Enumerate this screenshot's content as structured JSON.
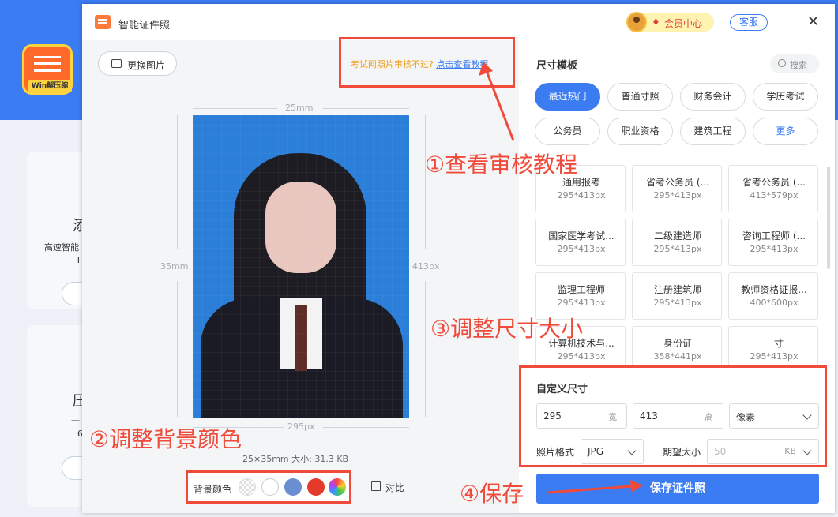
{
  "background_app": {
    "logo_text": "Win解压缩",
    "card1_heading_fragment": "添",
    "card1_desc_fragment_1": "高速智能",
    "card1_desc_fragment_2": "T",
    "card2_heading_fragment": "压",
    "card2_desc_fragment_1": "一",
    "card2_desc_fragment_2": "6"
  },
  "window": {
    "title": "智能证件照",
    "vip_label": "会员中心",
    "service_label": "客服",
    "close_glyph": "✕"
  },
  "toolbar": {
    "replace_image_label": "更换图片",
    "notice_text": "考试网照片审核不过?",
    "notice_link": "点击查看教程"
  },
  "preview": {
    "width_mm": "25mm",
    "height_mm": "35mm",
    "height_px": "413px",
    "width_px": "295px",
    "info_text": "25×35mm  大小: 31.3 KB"
  },
  "background_color": {
    "label": "背景颜色",
    "swatches": [
      "transparent",
      "#ffffff",
      "#6a8fd0",
      "#e33a2a",
      "multicolor"
    ]
  },
  "compare_label": "对比",
  "size_panel": {
    "title": "尺寸模板",
    "search_label": "搜索",
    "categories": [
      {
        "label": "最近热门",
        "active": true
      },
      {
        "label": "普通寸照",
        "active": false
      },
      {
        "label": "财务会计",
        "active": false
      },
      {
        "label": "学历考试",
        "active": false
      },
      {
        "label": "公务员",
        "active": false
      },
      {
        "label": "职业资格",
        "active": false
      },
      {
        "label": "建筑工程",
        "active": false
      },
      {
        "label": "更多",
        "active": false
      }
    ],
    "templates": [
      {
        "name": "通用报考",
        "size": "295*413px"
      },
      {
        "name": "省考公务员 (...",
        "size": "295*413px"
      },
      {
        "name": "省考公务员 (...",
        "size": "413*579px"
      },
      {
        "name": "国家医学考试...",
        "size": "295*413px"
      },
      {
        "name": "二级建造师",
        "size": "295*413px"
      },
      {
        "name": "咨询工程师 (...",
        "size": "295*413px"
      },
      {
        "name": "监理工程师",
        "size": "295*413px"
      },
      {
        "name": "注册建筑师",
        "size": "295*413px"
      },
      {
        "name": "教师资格证报...",
        "size": "400*600px"
      },
      {
        "name": "计算机技术与...",
        "size": "295*413px"
      },
      {
        "name": "身份证",
        "size": "358*441px"
      },
      {
        "name": "一寸",
        "size": "295*413px"
      }
    ]
  },
  "custom_size": {
    "title": "自定义尺寸",
    "width_value": "295",
    "width_unit": "宽",
    "height_value": "413",
    "height_unit": "高",
    "unit_select": "像素",
    "format_label": "照片格式",
    "format_value": "JPG",
    "expected_label": "期望大小",
    "expected_placeholder": "50",
    "expected_unit": "KB"
  },
  "save_button_label": "保存证件照",
  "annotations": {
    "step1": "①查看审核教程",
    "step2": "②调整背景颜色",
    "step3": "③调整尺寸大小",
    "step4": "④保存"
  },
  "colors": {
    "accent": "#3b7cf2",
    "annotation_red": "#f04a3a",
    "notice_orange": "#f0a020",
    "photo_bg": "#2b7fd8"
  }
}
